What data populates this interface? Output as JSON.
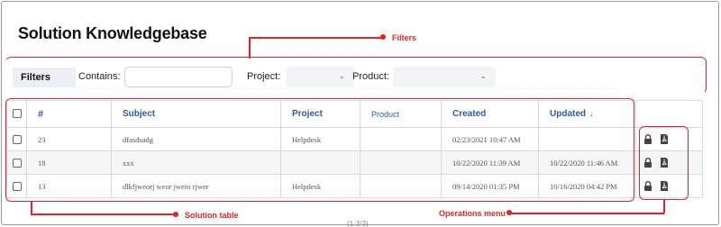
{
  "page": {
    "title": "Solution Knowledgebase"
  },
  "annotations": {
    "filters": "Filters",
    "solution_table": "Solution table",
    "operations_menu": "Operations menu"
  },
  "filters": {
    "tag": "Filters",
    "contains_label": "Contains:",
    "contains_value": "",
    "project_label": "Project:",
    "project_value": "",
    "product_label": "Product:",
    "product_value": ""
  },
  "table": {
    "columns": {
      "number": "#",
      "subject": "Subject",
      "project": "Project",
      "product": "Product",
      "created": "Created",
      "updated": "Updated",
      "updated_sort": "↓"
    },
    "rows": [
      {
        "number": "23",
        "subject": "dfasdsadg",
        "project": "Helpdesk",
        "product": "",
        "created": "02/23/2021 10:47 AM",
        "updated": ""
      },
      {
        "number": "18",
        "subject": "xxx",
        "project": "",
        "product": "",
        "created": "10/22/2020 11:39 AM",
        "updated": "10/22/2020 11:46 AM"
      },
      {
        "number": "13",
        "subject": "dlkfjweorj weor jweio rjwer",
        "project": "Helpdesk",
        "product": "",
        "created": "09/14/2020 01:35 PM",
        "updated": "10/16/2020 04:42 PM"
      }
    ]
  },
  "pager": {
    "text": "(1-3/3)"
  },
  "colors": {
    "accent": "#2c5aa0",
    "annotation": "#e02424"
  },
  "icons": {
    "lock": "lock-icon",
    "pdf": "pdf-icon"
  }
}
